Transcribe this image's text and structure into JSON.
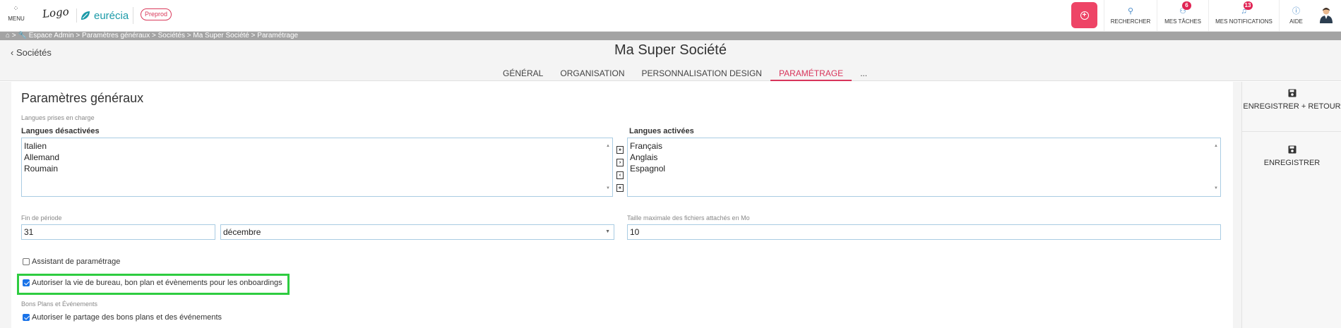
{
  "topbar": {
    "menu_label": "MENU",
    "logo_text": "Logo",
    "brand_name": "eurécia",
    "env_badge": "Preprod",
    "nav": [
      {
        "label": "RECHERCHER",
        "badge": ""
      },
      {
        "label": "MES TÂCHES",
        "badge": "6"
      },
      {
        "label": "MES NOTIFICATIONS",
        "badge": "13"
      },
      {
        "label": "AIDE",
        "badge": ""
      }
    ]
  },
  "breadcrumb": [
    "Espace Admin",
    "Paramètres généraux",
    "Sociétés",
    "Ma Super Société",
    "Paramétrage"
  ],
  "header": {
    "back_label": "Sociétés",
    "title": "Ma Super Société",
    "tabs": [
      {
        "label": "GÉNÉRAL",
        "active": false
      },
      {
        "label": "ORGANISATION",
        "active": false
      },
      {
        "label": "PERSONNALISATION DESIGN",
        "active": false
      },
      {
        "label": "PARAMÉTRAGE",
        "active": true
      },
      {
        "label": "...",
        "active": false
      }
    ]
  },
  "form": {
    "section_title": "Paramètres généraux",
    "languages_label": "Langues prises en charge",
    "disabled_title": "Langues désactivées",
    "disabled_items": [
      "Italien",
      "Allemand",
      "Roumain"
    ],
    "enabled_title": "Langues activées",
    "enabled_items": [
      "Français",
      "Anglais",
      "Espagnol"
    ],
    "period_label": "Fin de période",
    "period_day": "31",
    "period_month": "décembre",
    "max_size_label": "Taille maximale des fichiers attachés en Mo",
    "max_size_value": "10",
    "assistant_label": "Assistant de paramétrage",
    "assistant_checked": false,
    "onboarding_label": "Autoriser la vie de bureau, bon plan et évènements pour les onboardings",
    "onboarding_checked": true,
    "bons_plans_title": "Bons Plans et Événements",
    "sharing_label": "Autoriser le partage des bons plans et des événements",
    "sharing_checked": true
  },
  "side_actions": {
    "save_back": "ENREGISTRER + RETOUR",
    "save": "ENREGISTRER"
  },
  "colors": {
    "accent": "#d8355b",
    "primary_button": "#ee4466",
    "brand": "#1b9aa8",
    "highlight": "#2ecc40"
  }
}
